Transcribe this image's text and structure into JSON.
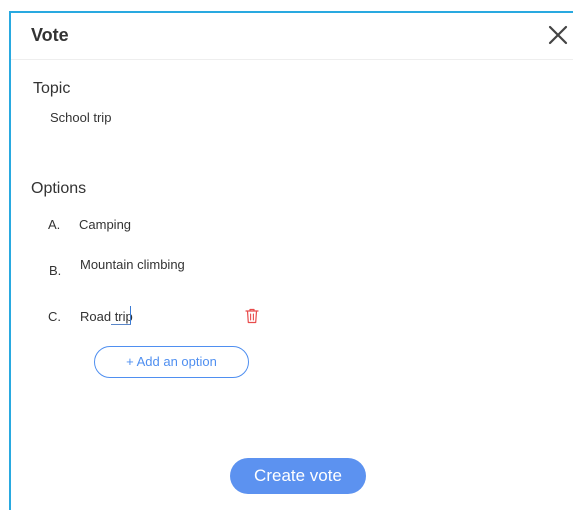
{
  "dialog": {
    "title": "Vote",
    "close_icon": "close-icon"
  },
  "topic": {
    "label": "Topic",
    "value": "School trip"
  },
  "options": {
    "label": "Options",
    "items": [
      {
        "letter": "A.",
        "text": "Camping"
      },
      {
        "letter": "B.",
        "text": "Mountain climbing"
      },
      {
        "letter": "C.",
        "text": "Road trip",
        "delete_icon": "trash-icon"
      }
    ],
    "add_label": "+ Add an option"
  },
  "actions": {
    "create_label": "Create vote"
  },
  "colors": {
    "accent": "#4f8ff0",
    "primary_button": "#5c92f0",
    "border": "#29a9e0",
    "delete": "#e84b4b"
  }
}
